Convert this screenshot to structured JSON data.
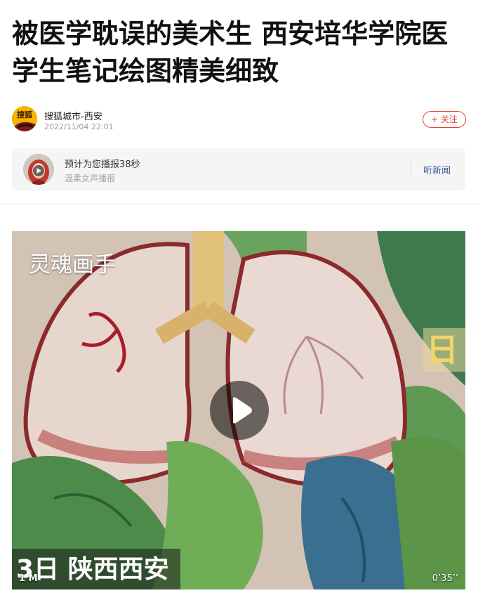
{
  "article": {
    "title": "被医学耽误的美术生 西安培华学院医学生笔记绘图精美细致"
  },
  "author": {
    "logo_text": "搜狐",
    "name": "搜狐城市-西安",
    "time": "2022/11/04 22:01",
    "follow_label": "+ 关注",
    "accent_color": "#e0452e"
  },
  "audio": {
    "title": "预计为您播报38秒",
    "subtitle": "温柔女声播报",
    "listen_label": "听新闻",
    "icon": "play-icon"
  },
  "video": {
    "watermark": "灵魂画手",
    "side_text": "日",
    "subtitle": "3日 陕西西安",
    "views": "1 M",
    "duration": "0’35’’",
    "play_icon": "play-icon"
  }
}
